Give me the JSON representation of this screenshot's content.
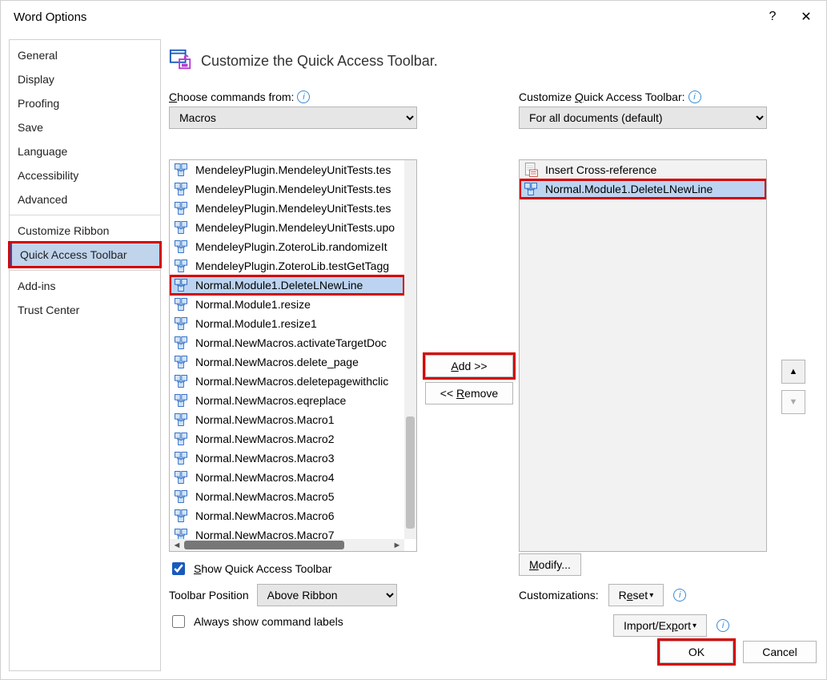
{
  "title": "Word Options",
  "sidebar": {
    "groups": [
      [
        "General",
        "Display",
        "Proofing",
        "Save",
        "Language",
        "Accessibility",
        "Advanced"
      ],
      [
        "Customize Ribbon",
        "Quick Access Toolbar"
      ],
      [
        "Add-ins",
        "Trust Center"
      ]
    ],
    "active": "Quick Access Toolbar"
  },
  "header": "Customize the Quick Access Toolbar.",
  "left": {
    "label": "Choose commands from:",
    "combo": "Macros",
    "items": [
      "MendeleyPlugin.MendeleyUnitTests.tes",
      "MendeleyPlugin.MendeleyUnitTests.tes",
      "MendeleyPlugin.MendeleyUnitTests.tes",
      "MendeleyPlugin.MendeleyUnitTests.upo",
      "MendeleyPlugin.ZoteroLib.randomizeIt",
      "MendeleyPlugin.ZoteroLib.testGetTagg",
      "Normal.Module1.DeleteLNewLine",
      "Normal.Module1.resize",
      "Normal.Module1.resize1",
      "Normal.NewMacros.activateTargetDoc",
      "Normal.NewMacros.delete_page",
      "Normal.NewMacros.deletepagewithclic",
      "Normal.NewMacros.eqreplace",
      "Normal.NewMacros.Macro1",
      "Normal.NewMacros.Macro2",
      "Normal.NewMacros.Macro3",
      "Normal.NewMacros.Macro4",
      "Normal.NewMacros.Macro5",
      "Normal.NewMacros.Macro6",
      "Normal.NewMacros.Macro7"
    ],
    "selectedIndex": 6
  },
  "right": {
    "label": "Customize Quick Access Toolbar:",
    "combo": "For all documents (default)",
    "items": [
      {
        "type": "crossref",
        "label": "Insert Cross-reference"
      },
      {
        "type": "macro",
        "label": "Normal.Module1.DeleteLNewLine"
      }
    ],
    "selectedIndex": 1
  },
  "centerButtons": {
    "add": "Add >>",
    "remove": "<< Remove"
  },
  "belowLeft": {
    "showQAT": "Show Quick Access Toolbar",
    "toolbarPositionLabel": "Toolbar Position",
    "toolbarPositionValue": "Above Ribbon",
    "alwaysShow": "Always show command labels"
  },
  "belowRight": {
    "modify": "Modify...",
    "customizationsLabel": "Customizations:",
    "reset": "Reset",
    "importExport": "Import/Export"
  },
  "footer": {
    "ok": "OK",
    "cancel": "Cancel"
  }
}
